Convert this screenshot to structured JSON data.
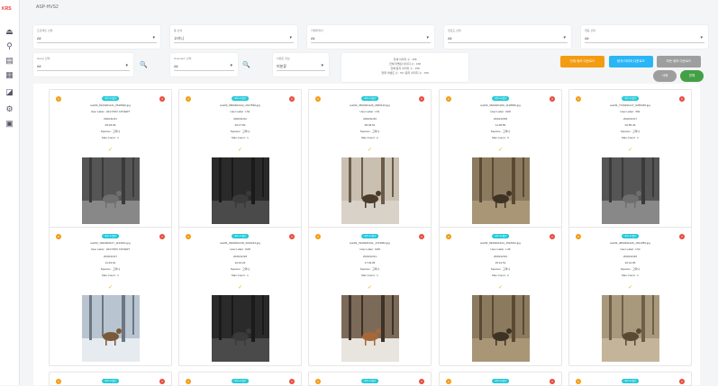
{
  "app": {
    "logo": "KRS",
    "title": "ASP-HVS2"
  },
  "sidebar": {
    "icons": [
      "upload-icon",
      "search-icon",
      "document-icon",
      "calendar-icon",
      "chart-icon",
      "gear-icon",
      "folder-icon"
    ]
  },
  "filters": {
    "row1": [
      {
        "label": "프로젝트 선택",
        "value": "All"
      },
      {
        "label": "종 선택",
        "value": "고라니"
      },
      {
        "label": "카메라위치",
        "value": "All"
      },
      {
        "label": "항로도 선택",
        "value": "All"
      },
      {
        "label": "행동 선택",
        "value": "All"
      }
    ],
    "row2": [
      {
        "label": "Name 선택",
        "value": "All"
      },
      {
        "label": "Detecator 선택",
        "value": "All"
      },
      {
        "label": "이벤트 정보",
        "value": "미분류"
      }
    ]
  },
  "stats": [
    "전체 이미지 수 : 158",
    "전체 라벨된 이미지 수 : 158",
    "전체 탐지 이미지 수 : 158",
    "현재 이벤트 수 : 53 / 탐지 이미지 수 : 158"
  ],
  "buttons": {
    "btn1": "전체 정보 다운로드",
    "btn2": "탐지/이미지 다운로드",
    "btn3": "모든 정보 다운로드",
    "btn4": "삭제",
    "btn5": "전체"
  },
  "colors": {
    "accent": "#1ec8d8",
    "orange": "#f39c12",
    "blue": "#29b6f6",
    "gray": "#9e9e9e",
    "green": "#43a047",
    "red": "#e74c3c"
  },
  "cards": [
    {
      "tag": "데이터라벨링",
      "file": "test03_8120201121_0518092.jpg",
      "user_label": "User Label : HF2 PRO COVERT",
      "date": "2020/11/21",
      "time": "05:18:09",
      "species": "Species : 고라니",
      "max": "Max Count : 1",
      "check": "✓",
      "chk": "0",
      "del": "X",
      "scene": "night"
    },
    {
      "tag": "데이터라벨링",
      "file": "test03_6820201122_2017590.jpg",
      "user_label": "User Label : L51",
      "date": "2020/11/22",
      "time": "20:17:59",
      "species": "Species : 고라니",
      "max": "Max Count : 1",
      "check": "✓",
      "chk": "0",
      "del": "X",
      "scene": "night-dark"
    },
    {
      "tag": "데이터라벨링",
      "file": "test03_3520201126_0845123.jpg",
      "user_label": "User Label : L51",
      "date": "2020/11/26",
      "time": "08:45:51",
      "species": "Species : 고라니",
      "max": "Max Count : 2",
      "check": "✓",
      "chk": "0",
      "del": "X",
      "scene": "forest-snow"
    },
    {
      "tag": "데이터라벨링",
      "file": "test03_3620201209_1148560.jpg",
      "user_label": "User Label : D28",
      "date": "2020/12/09",
      "time": "11:48:56",
      "species": "Species : 고라니",
      "max": "Max Count : 3",
      "check": "✓",
      "chk": "0",
      "del": "X",
      "scene": "forest-day"
    },
    {
      "tag": "데이터라벨링",
      "file": "test03_7720201217_0255435.jpg",
      "user_label": "User Label : S51",
      "date": "2020/12/17",
      "time": "02:55:43",
      "species": "Species : 고라니",
      "max": "Max Count : 1",
      "check": "✓",
      "chk": "0",
      "del": "X",
      "scene": "night"
    },
    {
      "tag": "데이터라벨링",
      "file": "test03_1042020127_1143011.jpg",
      "user_label": "User Label : HF2 PRO COVERT",
      "date": "2020/12/17",
      "time": "11:43:01",
      "species": "Species : 고라니",
      "max": "Max Count : 1",
      "check": "✓",
      "chk": "0",
      "del": "X",
      "scene": "snow-day"
    },
    {
      "tag": "데이터라벨링",
      "file": "test03_3920201218_2216244.jpg",
      "user_label": "User Label : D28",
      "date": "2020/12/18",
      "time": "22:16:24",
      "species": "Species : 고라니",
      "max": "Max Count : 1",
      "check": "✓",
      "chk": "0",
      "del": "X",
      "scene": "night-dark"
    },
    {
      "tag": "데이터라벨링",
      "file": "test03_3120201221_1743052.jpg",
      "user_label": "User Label : D28",
      "date": "2020/12/21",
      "time": "17:43:05",
      "species": "Species : 고라니",
      "max": "Max Count : 1",
      "check": "✓",
      "chk": "0",
      "del": "X",
      "scene": "snow-deer"
    },
    {
      "tag": "데이터라벨링",
      "file": "test03_9920201224_1512512.jpg",
      "user_label": "User Label : L46",
      "date": "2020/12/24",
      "time": "15:12:51",
      "species": "Species : 고라니",
      "max": "Max Count : 2",
      "check": "✓",
      "chk": "0",
      "del": "X",
      "scene": "forest-day"
    },
    {
      "tag": "데이터라벨링",
      "file": "test03_4820201226_1641050.jpg",
      "user_label": "User Label : L54",
      "date": "2020/12/26",
      "time": "16:41:05",
      "species": "Species : 고라니",
      "max": "Max Count : 1",
      "check": "✓",
      "chk": "0",
      "del": "X",
      "scene": "forest-light"
    }
  ],
  "partial_cards": [
    {
      "tag": "데이터라벨링",
      "chk": "0",
      "del": "X"
    },
    {
      "tag": "데이터라벨링",
      "chk": "0",
      "del": "X"
    },
    {
      "tag": "데이터라벨링",
      "chk": "0",
      "del": "X"
    },
    {
      "tag": "데이터라벨링",
      "chk": "0",
      "del": "X"
    },
    {
      "tag": "데이터라벨링",
      "chk": "0",
      "del": "X"
    }
  ]
}
